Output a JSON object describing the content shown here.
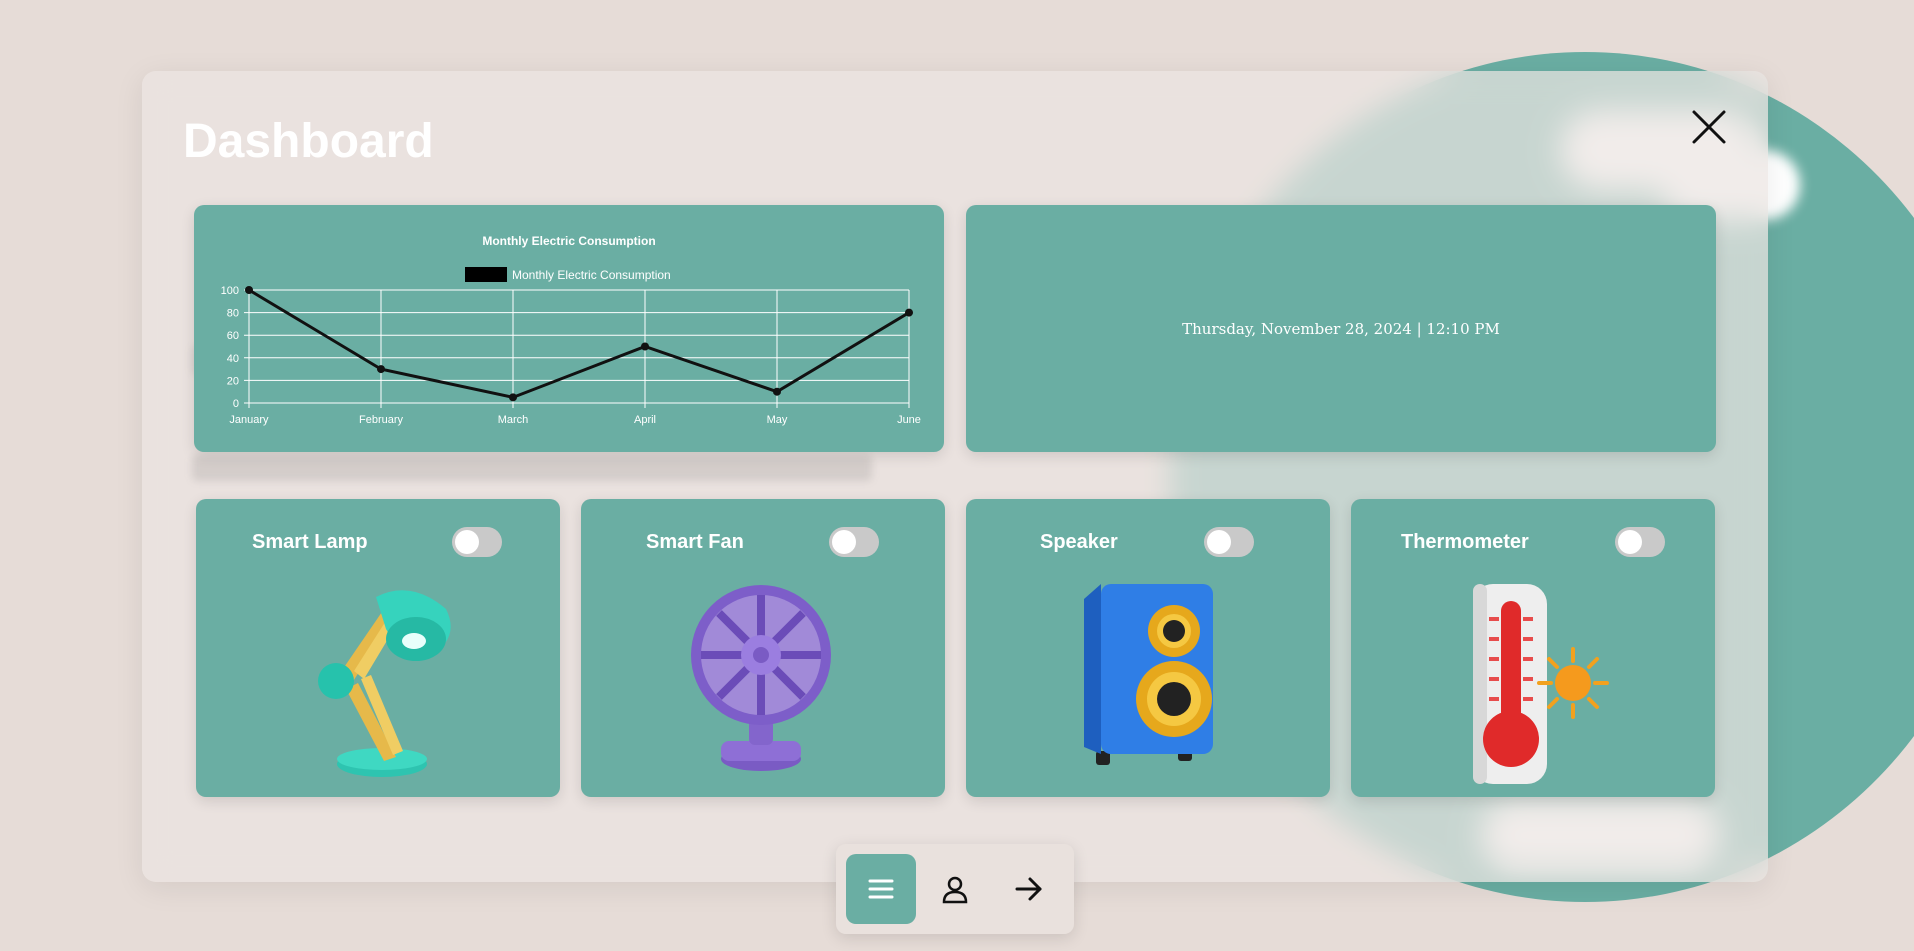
{
  "page": {
    "title": "Dashboard"
  },
  "colors": {
    "card": "#6aaea3",
    "background": "#e6dcd7",
    "panel": "#ece5e2",
    "line": "#111111",
    "toggle_off": "#c9c9c9"
  },
  "chart_data": {
    "type": "line",
    "title": "Monthly Electric Consumption",
    "legend": "top",
    "categories": [
      "January",
      "February",
      "March",
      "April",
      "May",
      "June"
    ],
    "series": [
      {
        "name": "Monthly Electric Consumption",
        "values": [
          100,
          30,
          5,
          50,
          10,
          80
        ]
      }
    ],
    "yticks": [
      "0",
      "20",
      "40",
      "60",
      "80",
      "100"
    ],
    "ylim": [
      0,
      100
    ],
    "grid": true
  },
  "datetime": {
    "text": "Thursday, November 28, 2024 | 12:10 PM"
  },
  "devices": [
    {
      "name": "Smart Lamp",
      "icon": "lamp-icon",
      "on": false
    },
    {
      "name": "Smart Fan",
      "icon": "fan-icon",
      "on": false
    },
    {
      "name": "Speaker",
      "icon": "speaker-icon",
      "on": false
    },
    {
      "name": "Thermometer",
      "icon": "thermometer-icon",
      "on": false
    }
  ],
  "nav": {
    "items": [
      {
        "icon": "menu-icon",
        "active": true
      },
      {
        "icon": "user-icon",
        "active": false
      },
      {
        "icon": "arrow-right-icon",
        "active": false
      }
    ]
  },
  "icons": {
    "close": "close-icon"
  }
}
